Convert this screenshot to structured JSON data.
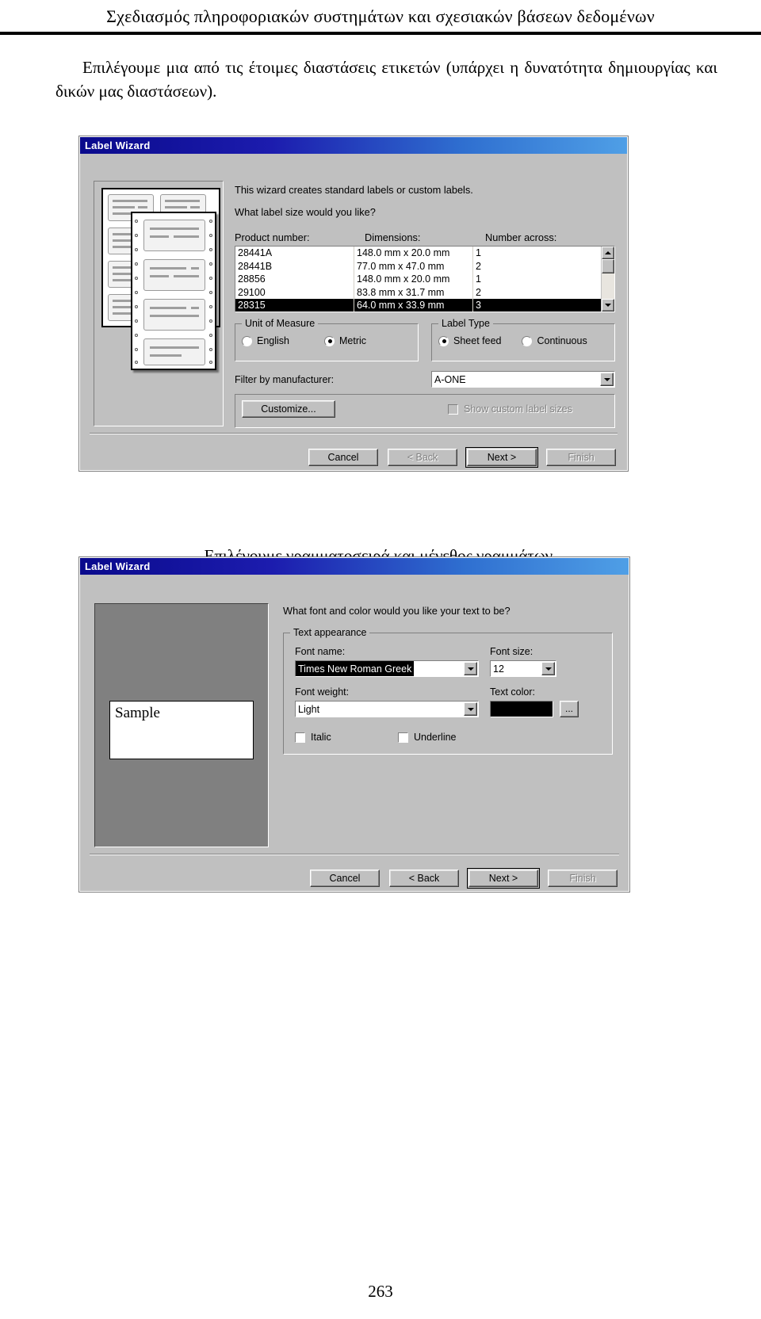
{
  "document": {
    "header_title": "Σχεδιασμός πληροφοριακών συστημάτων και σχεσιακών βάσεων δεδομένων",
    "paragraph_1": "Επιλέγουμε μια από τις έτοιμες διαστάσεις ετικετών (υπάρχει η δυνατότητα δημιουργίας και δικών μας διαστάσεων).",
    "paragraph_2": "Επιλέγουμε γραμματοσειρά και μέγεθος γραμμάτων.",
    "page_number": "263"
  },
  "dialog1": {
    "title": "Label Wizard",
    "intro_line1": "This wizard creates standard labels or custom labels.",
    "intro_line2": "What label size would you like?",
    "columns": [
      "Product number:",
      "Dimensions:",
      "Number across:"
    ],
    "rows": [
      {
        "product": "28441A",
        "dimensions": "148.0 mm x 20.0 mm",
        "across": "1",
        "selected": false
      },
      {
        "product": "28441B",
        "dimensions": "77.0 mm x 47.0 mm",
        "across": "2",
        "selected": false
      },
      {
        "product": "28856",
        "dimensions": "148.0 mm x 20.0 mm",
        "across": "1",
        "selected": false
      },
      {
        "product": "29100",
        "dimensions": "83.8 mm x 31.7 mm",
        "across": "2",
        "selected": false
      },
      {
        "product": "28315",
        "dimensions": "64.0 mm x 33.9 mm",
        "across": "3",
        "selected": true
      }
    ],
    "unit_of_measure": {
      "group_label": "Unit of Measure",
      "options": [
        {
          "label": "English",
          "checked": false
        },
        {
          "label": "Metric",
          "checked": true
        }
      ]
    },
    "label_type": {
      "group_label": "Label Type",
      "options": [
        {
          "label": "Sheet feed",
          "checked": true
        },
        {
          "label": "Continuous",
          "checked": false
        }
      ]
    },
    "filter_label": "Filter by  manufacturer:",
    "filter_value": "A-ONE",
    "customize_button": "Customize...",
    "show_custom_checkbox": "Show custom label sizes",
    "show_custom_checked": false,
    "show_custom_disabled": true,
    "buttons": [
      {
        "label": "Cancel",
        "disabled": false,
        "default": false
      },
      {
        "label": "< Back",
        "disabled": true,
        "default": false
      },
      {
        "label": "Next >",
        "disabled": false,
        "default": true
      },
      {
        "label": "Finish",
        "disabled": true,
        "default": false
      }
    ]
  },
  "dialog2": {
    "title": "Label Wizard",
    "prompt": "What font and color would you like your text to be?",
    "group_label": "Text appearance",
    "font_name_label": "Font name:",
    "font_name_value": "Times New Roman Greek",
    "font_size_label": "Font size:",
    "font_size_value": "12",
    "font_weight_label": "Font weight:",
    "font_weight_value": "Light",
    "text_color_label": "Text color:",
    "text_color_value": "#000000",
    "color_picker_button": "...",
    "italic_label": "Italic",
    "italic_checked": false,
    "underline_label": "Underline",
    "underline_checked": false,
    "sample_text": "Sample",
    "buttons": [
      {
        "label": "Cancel",
        "disabled": false,
        "default": false
      },
      {
        "label": "< Back",
        "disabled": false,
        "default": false
      },
      {
        "label": "Next >",
        "disabled": false,
        "default": true
      },
      {
        "label": "Finish",
        "disabled": true,
        "default": false
      }
    ]
  }
}
